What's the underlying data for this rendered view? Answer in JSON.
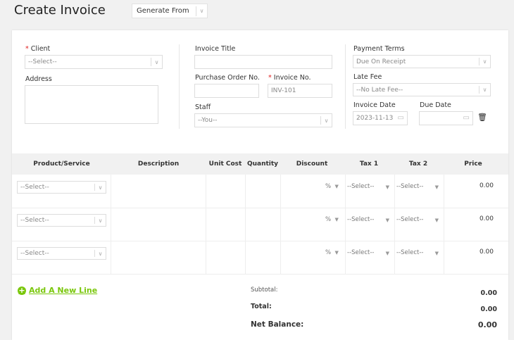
{
  "header": {
    "title": "Create Invoice",
    "generate_from": "Generate From"
  },
  "form": {
    "client_label": "Client",
    "client_value": "--Select--",
    "address_label": "Address",
    "invoice_title_label": "Invoice Title",
    "po_label": "Purchase Order No.",
    "invoice_no_label": "Invoice No.",
    "invoice_no_value": "INV-101",
    "staff_label": "Staff",
    "staff_value": "--You--",
    "payment_terms_label": "Payment Terms",
    "payment_terms_value": "Due On Receipt",
    "late_fee_label": "Late Fee",
    "late_fee_value": "--No Late Fee--",
    "invoice_date_label": "Invoice Date",
    "invoice_date_value": "2023-11-13",
    "due_date_label": "Due Date"
  },
  "table": {
    "headers": [
      "Product/Service",
      "Description",
      "Unit Cost",
      "Quantity",
      "Discount",
      "Tax 1",
      "Tax 2",
      "Price"
    ],
    "rows": [
      {
        "product": "--Select--",
        "discount_unit": "%",
        "tax1": "--Select--",
        "tax2": "--Select--",
        "price": "0.00"
      },
      {
        "product": "--Select--",
        "discount_unit": "%",
        "tax1": "--Select--",
        "tax2": "--Select--",
        "price": "0.00"
      },
      {
        "product": "--Select--",
        "discount_unit": "%",
        "tax1": "--Select--",
        "tax2": "--Select--",
        "price": "0.00"
      }
    ]
  },
  "footer": {
    "add_line": "Add A New Line",
    "subtotal_label": "Subtotal:",
    "subtotal": "0.00",
    "total_label": "Total:",
    "total": "0.00",
    "net_label": "Net Balance:",
    "net": "0.00"
  }
}
